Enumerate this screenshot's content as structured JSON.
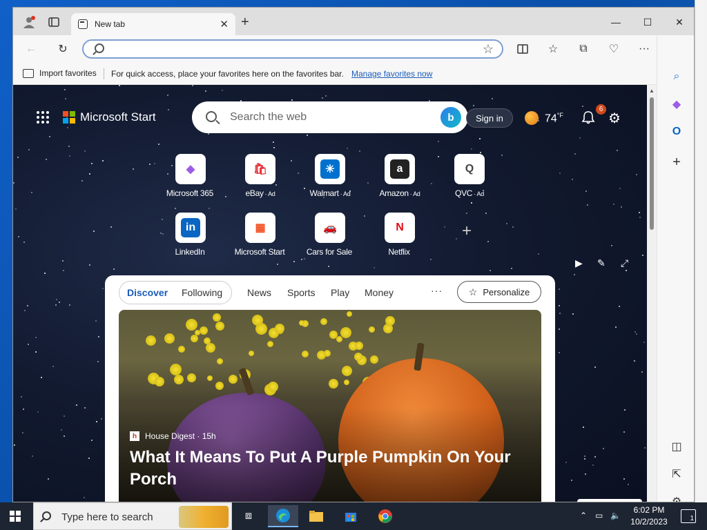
{
  "browser": {
    "tab_title": "New tab",
    "tab_close": "✕",
    "new_tab": "+",
    "address_placeholder": "",
    "window_controls": {
      "minimize": "—",
      "maximize": "☐",
      "close": "✕"
    }
  },
  "favorites_bar": {
    "import_label": "Import favorites",
    "hint": "For quick access, place your favorites here on the favorites bar.",
    "manage_link": "Manage favorites now"
  },
  "ms_start": {
    "title": "Microsoft Start",
    "search_placeholder": "Search the web",
    "sign_in": "Sign in",
    "temperature": "74",
    "temperature_unit": "°F",
    "notification_count": "6",
    "logo_colors": [
      "#f25022",
      "#7fba00",
      "#00a4ef",
      "#ffb900"
    ]
  },
  "quick_links": [
    {
      "label": "Microsoft 365",
      "ad": "",
      "glyph": "◆",
      "color": "#9b5de5"
    },
    {
      "label": "eBay",
      "ad": "· Ad",
      "glyph": "🛍",
      "color": "#e53238"
    },
    {
      "label": "Walmart",
      "ad": "· Ad",
      "glyph": "✳",
      "color": "#ffffff",
      "bg": "#0071ce"
    },
    {
      "label": "Amazon",
      "ad": "· Ad",
      "glyph": "a",
      "color": "#ffffff",
      "bg": "#222222"
    },
    {
      "label": "QVC",
      "ad": "· Ad",
      "glyph": "Q",
      "color": "#444444"
    },
    {
      "label": "LinkedIn",
      "ad": "",
      "glyph": "in",
      "color": "#ffffff",
      "bg": "#0a66c2"
    },
    {
      "label": "Microsoft Start",
      "ad": "",
      "glyph": "▦",
      "color": "#f25022"
    },
    {
      "label": "Cars for Sale",
      "ad": "",
      "glyph": "🚗",
      "color": "#2b7de9"
    },
    {
      "label": "Netflix",
      "ad": "",
      "glyph": "N",
      "color": "#e50914"
    }
  ],
  "add_link": "+",
  "feed": {
    "tabs": [
      "Discover",
      "Following",
      "News",
      "Sports",
      "Play",
      "Money"
    ],
    "more": "···",
    "personalize": "Personalize",
    "article": {
      "source": "House Digest · 15h",
      "headline": "What It Means To Put A Purple Pumpkin On Your Porch"
    }
  },
  "taskbar": {
    "search_placeholder": "Type here to search",
    "time": "6:02 PM",
    "date": "10/2/2023",
    "notification_badge": "1"
  }
}
